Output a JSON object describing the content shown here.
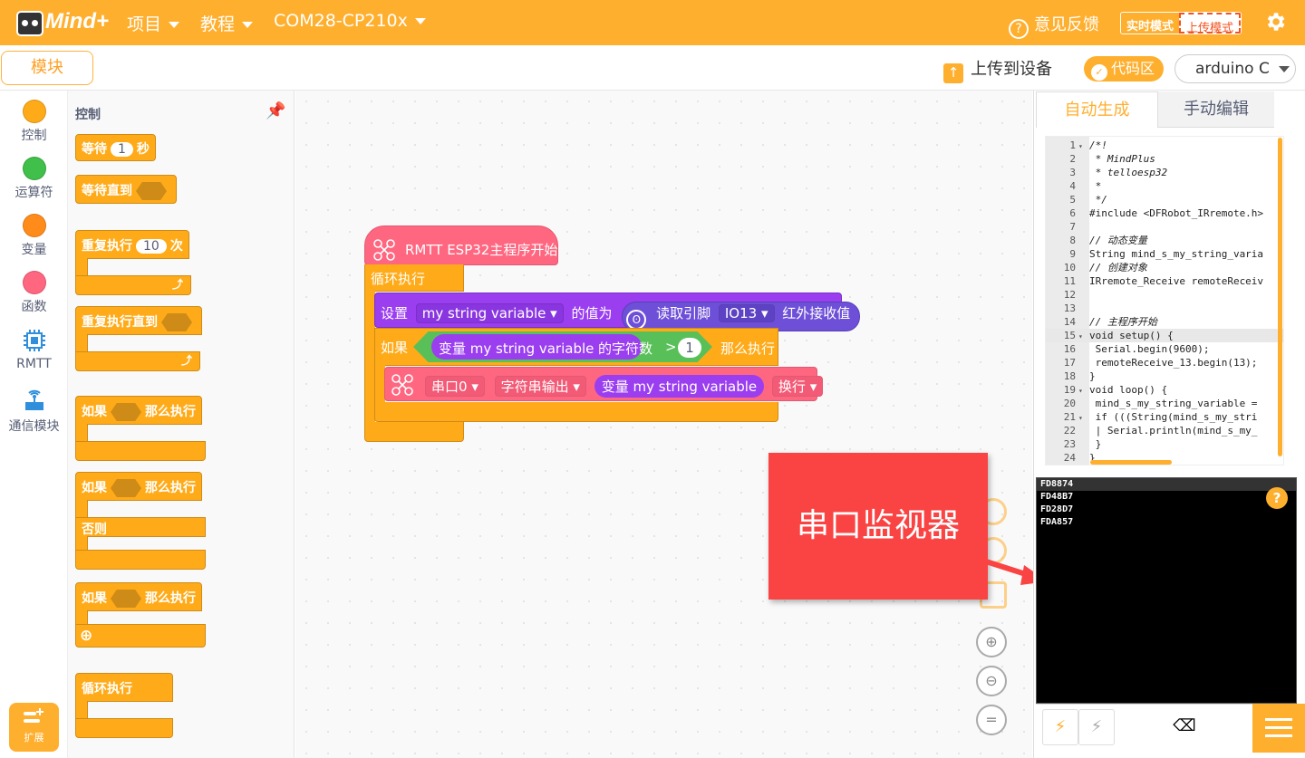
{
  "topbar": {
    "logo_text": "Mind+",
    "menu_project": "项目",
    "menu_tutorial": "教程",
    "menu_port": "COM28-CP210x",
    "feedback": "意见反馈",
    "mode_realtime": "实时模式",
    "mode_upload": "上传模式",
    "icons": {
      "feedback": "question-circle-icon",
      "settings": "gear-icon"
    },
    "bg_color": "#ffaf2e"
  },
  "toolbar": {
    "tab_modules": "模块",
    "upload_device": "上传到设备",
    "code_area": "代码区",
    "board_select": "arduino C"
  },
  "categories": [
    {
      "label": "控制",
      "color": "#ffab19"
    },
    {
      "label": "运算符",
      "color": "#40bf4a"
    },
    {
      "label": "变量",
      "color": "#ff8c1a"
    },
    {
      "label": "函数",
      "color": "#ff6680"
    },
    {
      "label": "RMTT",
      "icon": "chip-icon"
    },
    {
      "label": "通信模块",
      "icon": "antenna-icon"
    }
  ],
  "expand_label": "扩展",
  "palette": {
    "title": "控制",
    "blocks": {
      "wait": "等待",
      "wait_val": "1",
      "wait_unit": "秒",
      "wait_until": "等待直到",
      "repeat": "重复执行",
      "repeat_val": "10",
      "repeat_unit": "次",
      "repeat_until": "重复执行直到",
      "if1": "如果",
      "then1": "那么执行",
      "if2": "如果",
      "then2": "那么执行",
      "else2": "否则",
      "if3": "如果",
      "then3": "那么执行",
      "forever": "循环执行"
    }
  },
  "workspace": {
    "hat": "RMTT ESP32主程序开始",
    "loop": "循环执行",
    "set_label": "设置",
    "set_var": "my string variable",
    "set_to": "的值为",
    "read_pin": "读取引脚",
    "pin": "IO13",
    "ir_recv": "红外接收值",
    "if_label": "如果",
    "var_label": "变量 my string variable",
    "strlen": "的字符数",
    "gt": ">",
    "cmp_val": "1",
    "then_label": "那么执行",
    "serial": "串口0",
    "str_out": "字符串输出",
    "var_label2": "变量 my string variable",
    "newline": "换行"
  },
  "callout_text": "串口监视器",
  "code_tabs": {
    "auto": "自动生成",
    "manual": "手动编辑"
  },
  "code_lines": [
    {
      "n": "1",
      "t": "/*!",
      "c": "c-cm",
      "f": true
    },
    {
      "n": "2",
      "t": " * MindPlus",
      "c": "c-cm"
    },
    {
      "n": "3",
      "t": " * telloesp32",
      "c": "c-cm"
    },
    {
      "n": "4",
      "t": " *",
      "c": "c-cm"
    },
    {
      "n": "5",
      "t": " */",
      "c": "c-cm"
    },
    {
      "n": "6",
      "t": "#include <DFRobot_IRremote.h>",
      "c": "c-kw"
    },
    {
      "n": "7",
      "t": "",
      "c": ""
    },
    {
      "n": "8",
      "t": "// 动态变量",
      "c": "c-cm"
    },
    {
      "n": "9",
      "t": "String mind_s_my_string_varia",
      "c": ""
    },
    {
      "n": "10",
      "t": "// 创建对象",
      "c": "c-cm"
    },
    {
      "n": "11",
      "t": "IRremote_Receive remoteReceiv",
      "c": ""
    },
    {
      "n": "12",
      "t": "",
      "c": ""
    },
    {
      "n": "13",
      "t": "",
      "c": ""
    },
    {
      "n": "14",
      "t": "// 主程序开始",
      "c": "c-cm"
    },
    {
      "n": "15",
      "t": "void setup() {",
      "c": "",
      "f": true
    },
    {
      "n": "16",
      "t": "  Serial.begin(9600);",
      "c": ""
    },
    {
      "n": "17",
      "t": "  remoteReceive_13.begin(13);",
      "c": ""
    },
    {
      "n": "18",
      "t": "}",
      "c": ""
    },
    {
      "n": "19",
      "t": "void loop() {",
      "c": "",
      "f": true
    },
    {
      "n": "20",
      "t": "  mind_s_my_string_variable =",
      "c": ""
    },
    {
      "n": "21",
      "t": "  if (((String(mind_s_my_stri",
      "c": "",
      "f": true
    },
    {
      "n": "22",
      "t": "  | Serial.println(mind_s_my_",
      "c": ""
    },
    {
      "n": "23",
      "t": "  }",
      "c": ""
    },
    {
      "n": "24",
      "t": "}",
      "c": ""
    }
  ],
  "serial_output": [
    "FD8874",
    "FD48B7",
    "FD28D7",
    "FDA857"
  ],
  "serial_icons": [
    "usb-connect-icon",
    "usb-disconnect-icon",
    "clear-icon",
    "menu-icon"
  ]
}
